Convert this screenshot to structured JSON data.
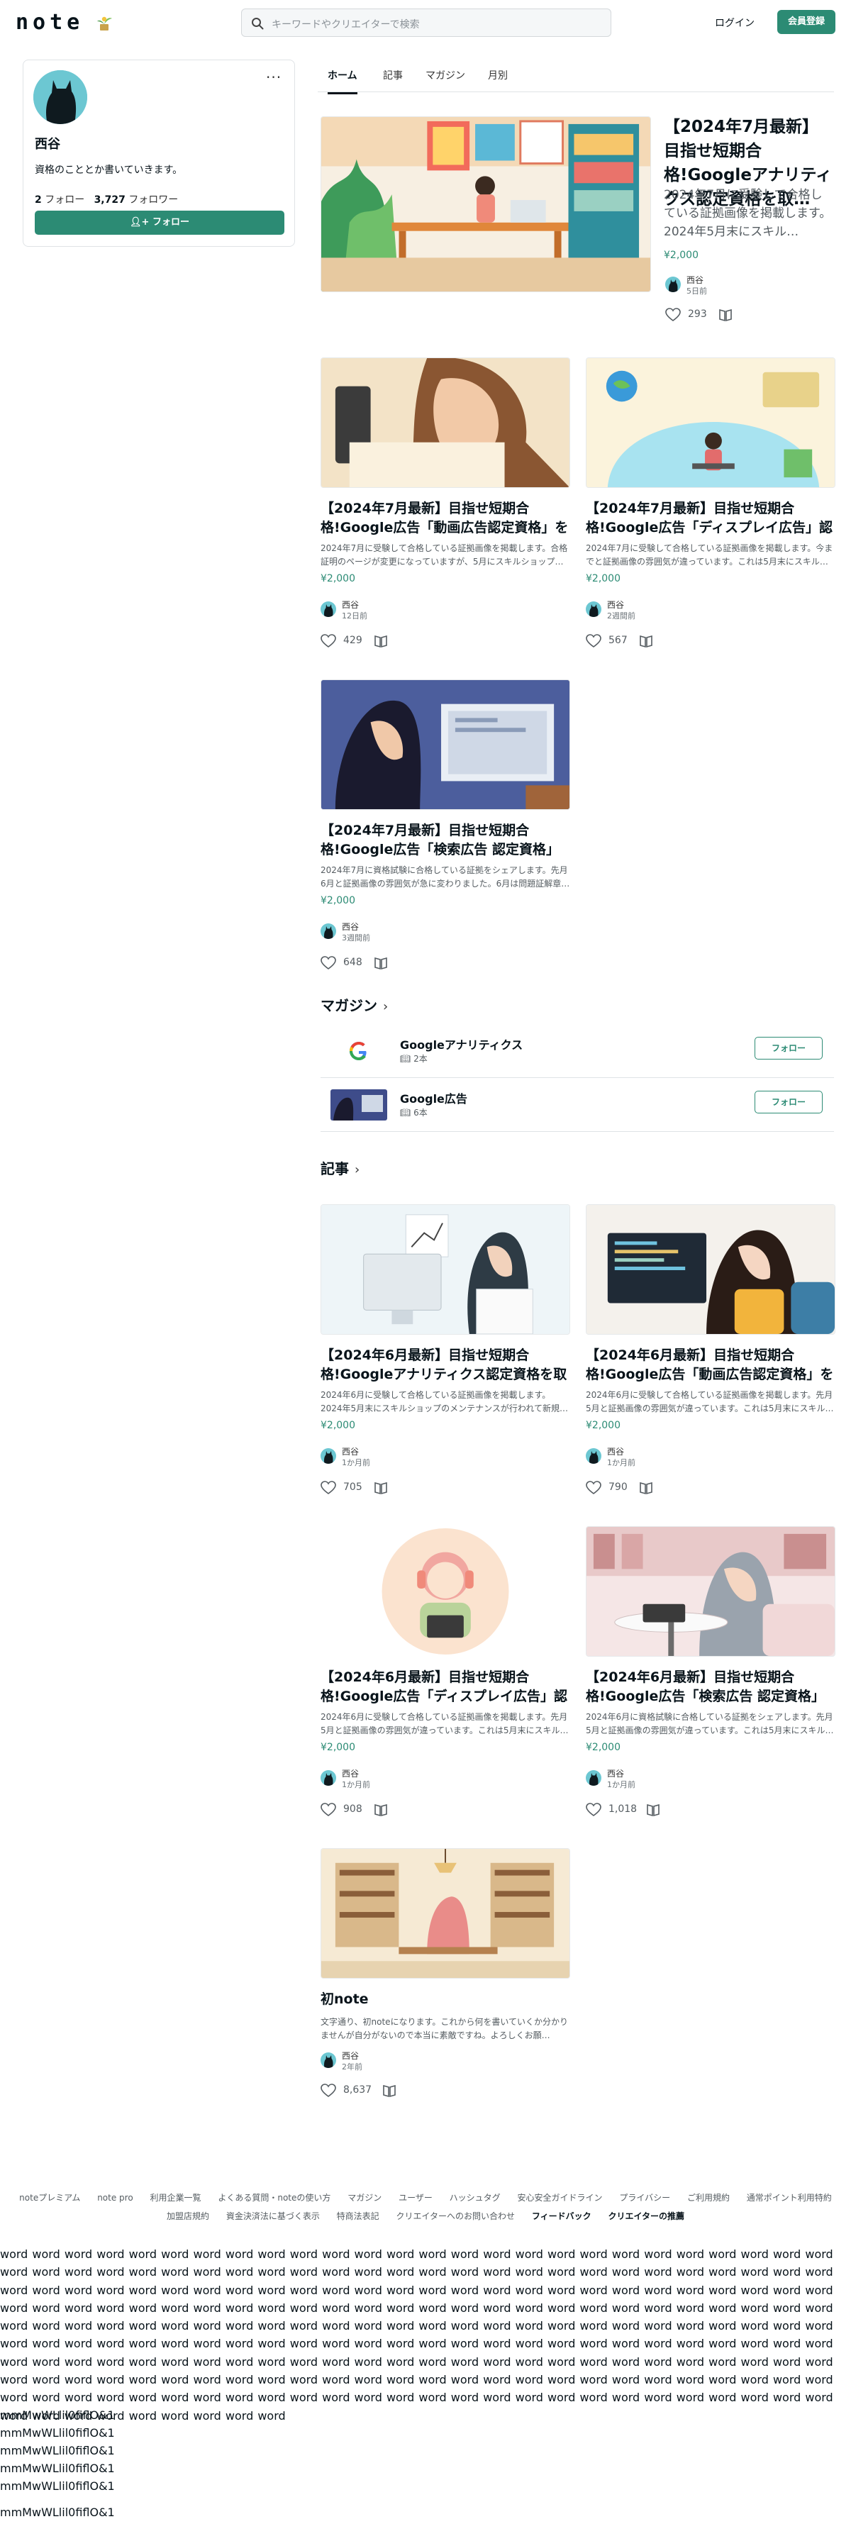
{
  "header": {
    "logo": "note",
    "search_placeholder": "キーワードやクリエイターで検索",
    "login": "ログイン",
    "signup": "会員登録"
  },
  "profile": {
    "name": "西谷",
    "bio": "資格のこととか書いていきます。",
    "following_count": "2",
    "following_label": "フォロー",
    "followers_count": "3,727",
    "followers_label": "フォロワー",
    "follow_button": "フォロー"
  },
  "tabs": [
    "ホーム",
    "記事",
    "マガジン",
    "月別"
  ],
  "featured": {
    "title": "【2024年7月最新】目指せ短期合格!Googleアナリティクス認定資格を取…",
    "excerpt": "2024年7月に受験して合格している証拠画像を掲載します。2024年5月末にスキル…",
    "price": "¥2,000",
    "author": "西谷",
    "time": "5日前",
    "likes": "293"
  },
  "cards_top": [
    {
      "title": "【2024年7月最新】目指せ短期合格!Google広告「動画広告認定資格」を取得…",
      "excerpt": "2024年7月に受験して合格している証拠画像を掲載します。合格証明のページが変更になっていますが、5月にスキルショップ…",
      "price": "¥2,000",
      "author": "西谷",
      "time": "12日前",
      "likes": "429"
    },
    {
      "title": "【2024年7月最新】目指せ短期合格!Google広告「ディスプレイ広告」認定資…",
      "excerpt": "2024年7月に受験して合格している証拠画像を掲載します。今までと証拠画像の雰囲気が違っています。これは5月末にスキル…",
      "price": "¥2,000",
      "author": "西谷",
      "time": "2週間前",
      "likes": "567"
    },
    {
      "title": "【2024年7月最新】目指せ短期合格!Google広告「検索広告 認定資格」を取…",
      "excerpt": "2024年7月に資格試験に合格している証拠をシェアします。先月6月と証拠画像の雰囲気が急に変わりました。6月は問題証解章…",
      "price": "¥2,000",
      "author": "西谷",
      "time": "3週間前",
      "likes": "648"
    }
  ],
  "magazine_section": "マガジン",
  "magazines": [
    {
      "name": "Googleアナリティクス",
      "count": "2本",
      "button": "フォロー"
    },
    {
      "name": "Google広告",
      "count": "6本",
      "button": "フォロー"
    }
  ],
  "articles_section": "記事",
  "articles": [
    {
      "title": "【2024年6月最新】目指せ短期合格!Googleアナリティクス認定資格を取得し…",
      "excerpt": "2024年6月に受験して合格している証拠画像を掲載します。2024年5月末にスキルショップのメンテナンスが行われて新規…",
      "price": "¥2,000",
      "author": "西谷",
      "time": "1か月前",
      "likes": "705"
    },
    {
      "title": "【2024年6月最新】目指せ短期合格!Google広告「動画広告認定資格」を取得…",
      "excerpt": "2024年6月に受験して合格している証拠画像を掲載します。先月5月と証拠画像の雰囲気が違っています。これは5月末にスキル…",
      "price": "¥2,000",
      "author": "西谷",
      "time": "1か月前",
      "likes": "790"
    },
    {
      "title": "【2024年6月最新】目指せ短期合格!Google広告「ディスプレイ広告」認定資…",
      "excerpt": "2024年6月に受験して合格している証拠画像を掲載します。先月5月と証拠画像の雰囲気が違っています。これは5月末にスキル…",
      "price": "¥2,000",
      "author": "西谷",
      "time": "1か月前",
      "likes": "908"
    },
    {
      "title": "【2024年6月最新】目指せ短期合格!Google広告「検索広告 認定資格」を取…",
      "excerpt": "2024年6月に資格試験に合格している証拠をシェアします。先月5月と証拠画像の雰囲気が違っています。これは5月末にスキル…",
      "price": "¥2,000",
      "author": "西谷",
      "time": "1か月前",
      "likes": "1,018"
    },
    {
      "title": "初note",
      "excerpt": "文字通り、初noteになります。これから何を書いていくか分かりませんが自分がないので本当に素敵ですね。よろしくお願…",
      "price": "",
      "author": "西谷",
      "time": "2年前",
      "likes": "8,637"
    }
  ],
  "footer": {
    "row1": [
      "noteプレミアム",
      "note pro",
      "利用企業一覧",
      "よくある質問・noteの使い方",
      "マガジン",
      "ユーザー",
      "ハッシュタグ",
      "安心安全ガイドライン",
      "プライバシー",
      "ご利用規約",
      "通常ポイント利用特約"
    ],
    "row2": [
      "加盟店規約",
      "資金決済法に基づく表示",
      "特商法表記",
      "クリエイターへのお問い合わせ"
    ],
    "row2_bold": [
      "フィードバック",
      "クリエイターの推薦"
    ]
  },
  "filler_text": "word word word word word word word word word word word word word word word word word word word word word word word word word word word word word word word word word word word word word word word word word word word word word word word word word word word word word word word word word word word word word word word word word word word word word word word word word word word word word word word word word word word word word word word word word word word word word word word word word word word word word word word word word word word word word word word word word word word word word word word word word word word word word word word word word word word word word word word word word word word word word word word word word word word word word word word word word word word word word word word word word word word word word word word word word word word word word word word word word word word word word word word word word word word word word word word word word word word word word word word word word word word word word word word word word word word word word word word word word word word word word word word word word word word word word word word word word word word word word word word word word word word",
  "mm_lines": [
    "mmMwWLlil0fiflO&1",
    "mmMwWLlil0fiflO&1",
    "mmMwWLlil0fiflO&1",
    "mmMwWLlil0fiflO&1",
    "mmMwWLlil0fiflO&1",
    "mmMwWLlil0fiflO&1"
  ]
}
